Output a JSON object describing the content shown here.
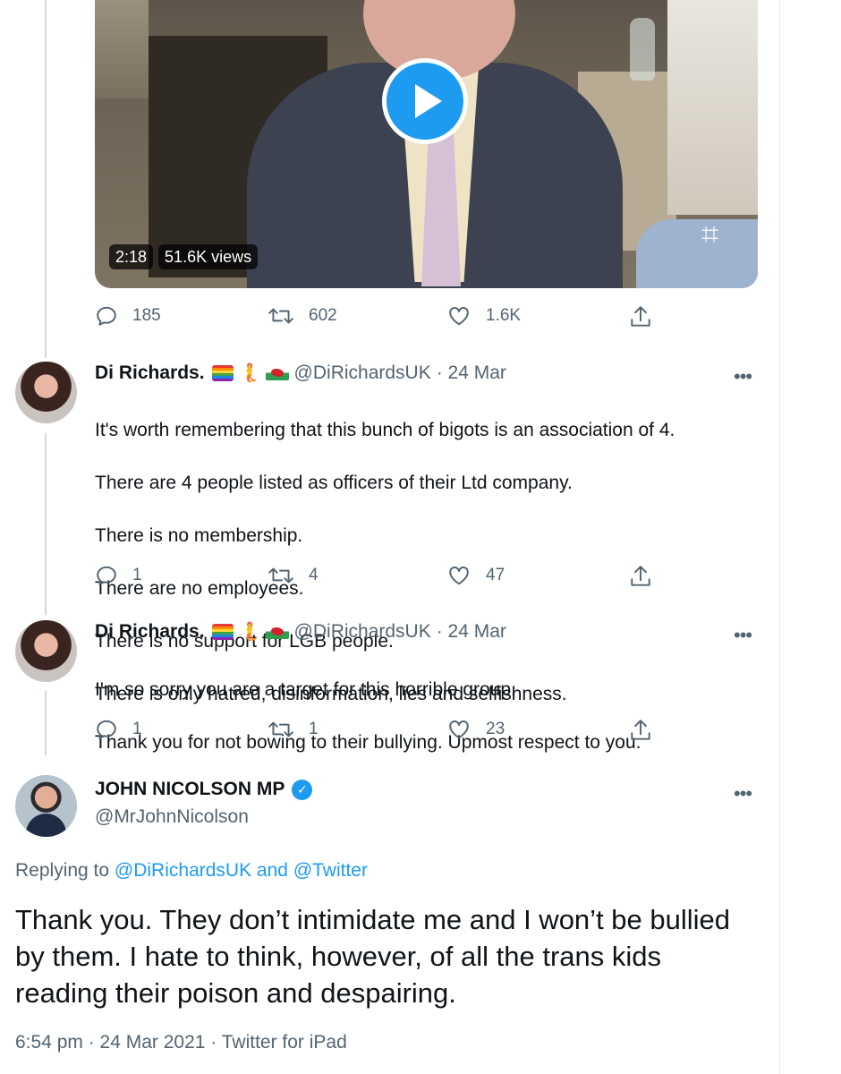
{
  "video": {
    "duration": "2:18",
    "views": "51.6K views"
  },
  "main_tweet_actions": {
    "replies": "185",
    "retweets": "602",
    "likes": "1.6K"
  },
  "reply1": {
    "name": "Di Richards.",
    "handle": "@DiRichardsUK",
    "date": "· 24 Mar",
    "lines": [
      "It's worth remembering that this bunch of bigots is an association of 4.",
      "There are 4 people listed as officers of their Ltd company.",
      "There is no membership.",
      "There are no employees.",
      "There is no support for LGB people.",
      "There is only hatred, disinformation, lies and selfishness."
    ],
    "replies": "1",
    "retweets": "4",
    "likes": "47"
  },
  "reply2": {
    "name": "Di Richards.",
    "handle": "@DiRichardsUK",
    "date": "· 24 Mar",
    "lines": [
      "I'm so sorry you are a target for this horrible group.",
      "Thank you for not bowing to their bullying. Upmost respect to you."
    ],
    "replies": "1",
    "retweets": "1",
    "likes": "23"
  },
  "focus": {
    "name": "JOHN NICOLSON MP",
    "handle": "@MrJohnNicolson",
    "replying_prefix": "Replying to ",
    "replying_user1": "@DiRichardsUK",
    "replying_and": " and ",
    "replying_user2": "@Twitter",
    "text": "Thank you. They don’t intimidate me and I won’t be bullied by them. I hate to think, however, of all the trans kids reading their poison and despairing.",
    "meta": "6:54 pm · 24 Mar 2021 · Twitter for iPad"
  },
  "more_label": "•••",
  "verified_glyph": "✓",
  "colors": {
    "accent": "#1d9bf0",
    "secondary_text": "#536471",
    "primary_text": "#0f1419"
  },
  "icons": {
    "reply": "reply-icon",
    "retweet": "retweet-icon",
    "like": "heart-icon",
    "share": "share-icon",
    "play": "play-icon"
  }
}
